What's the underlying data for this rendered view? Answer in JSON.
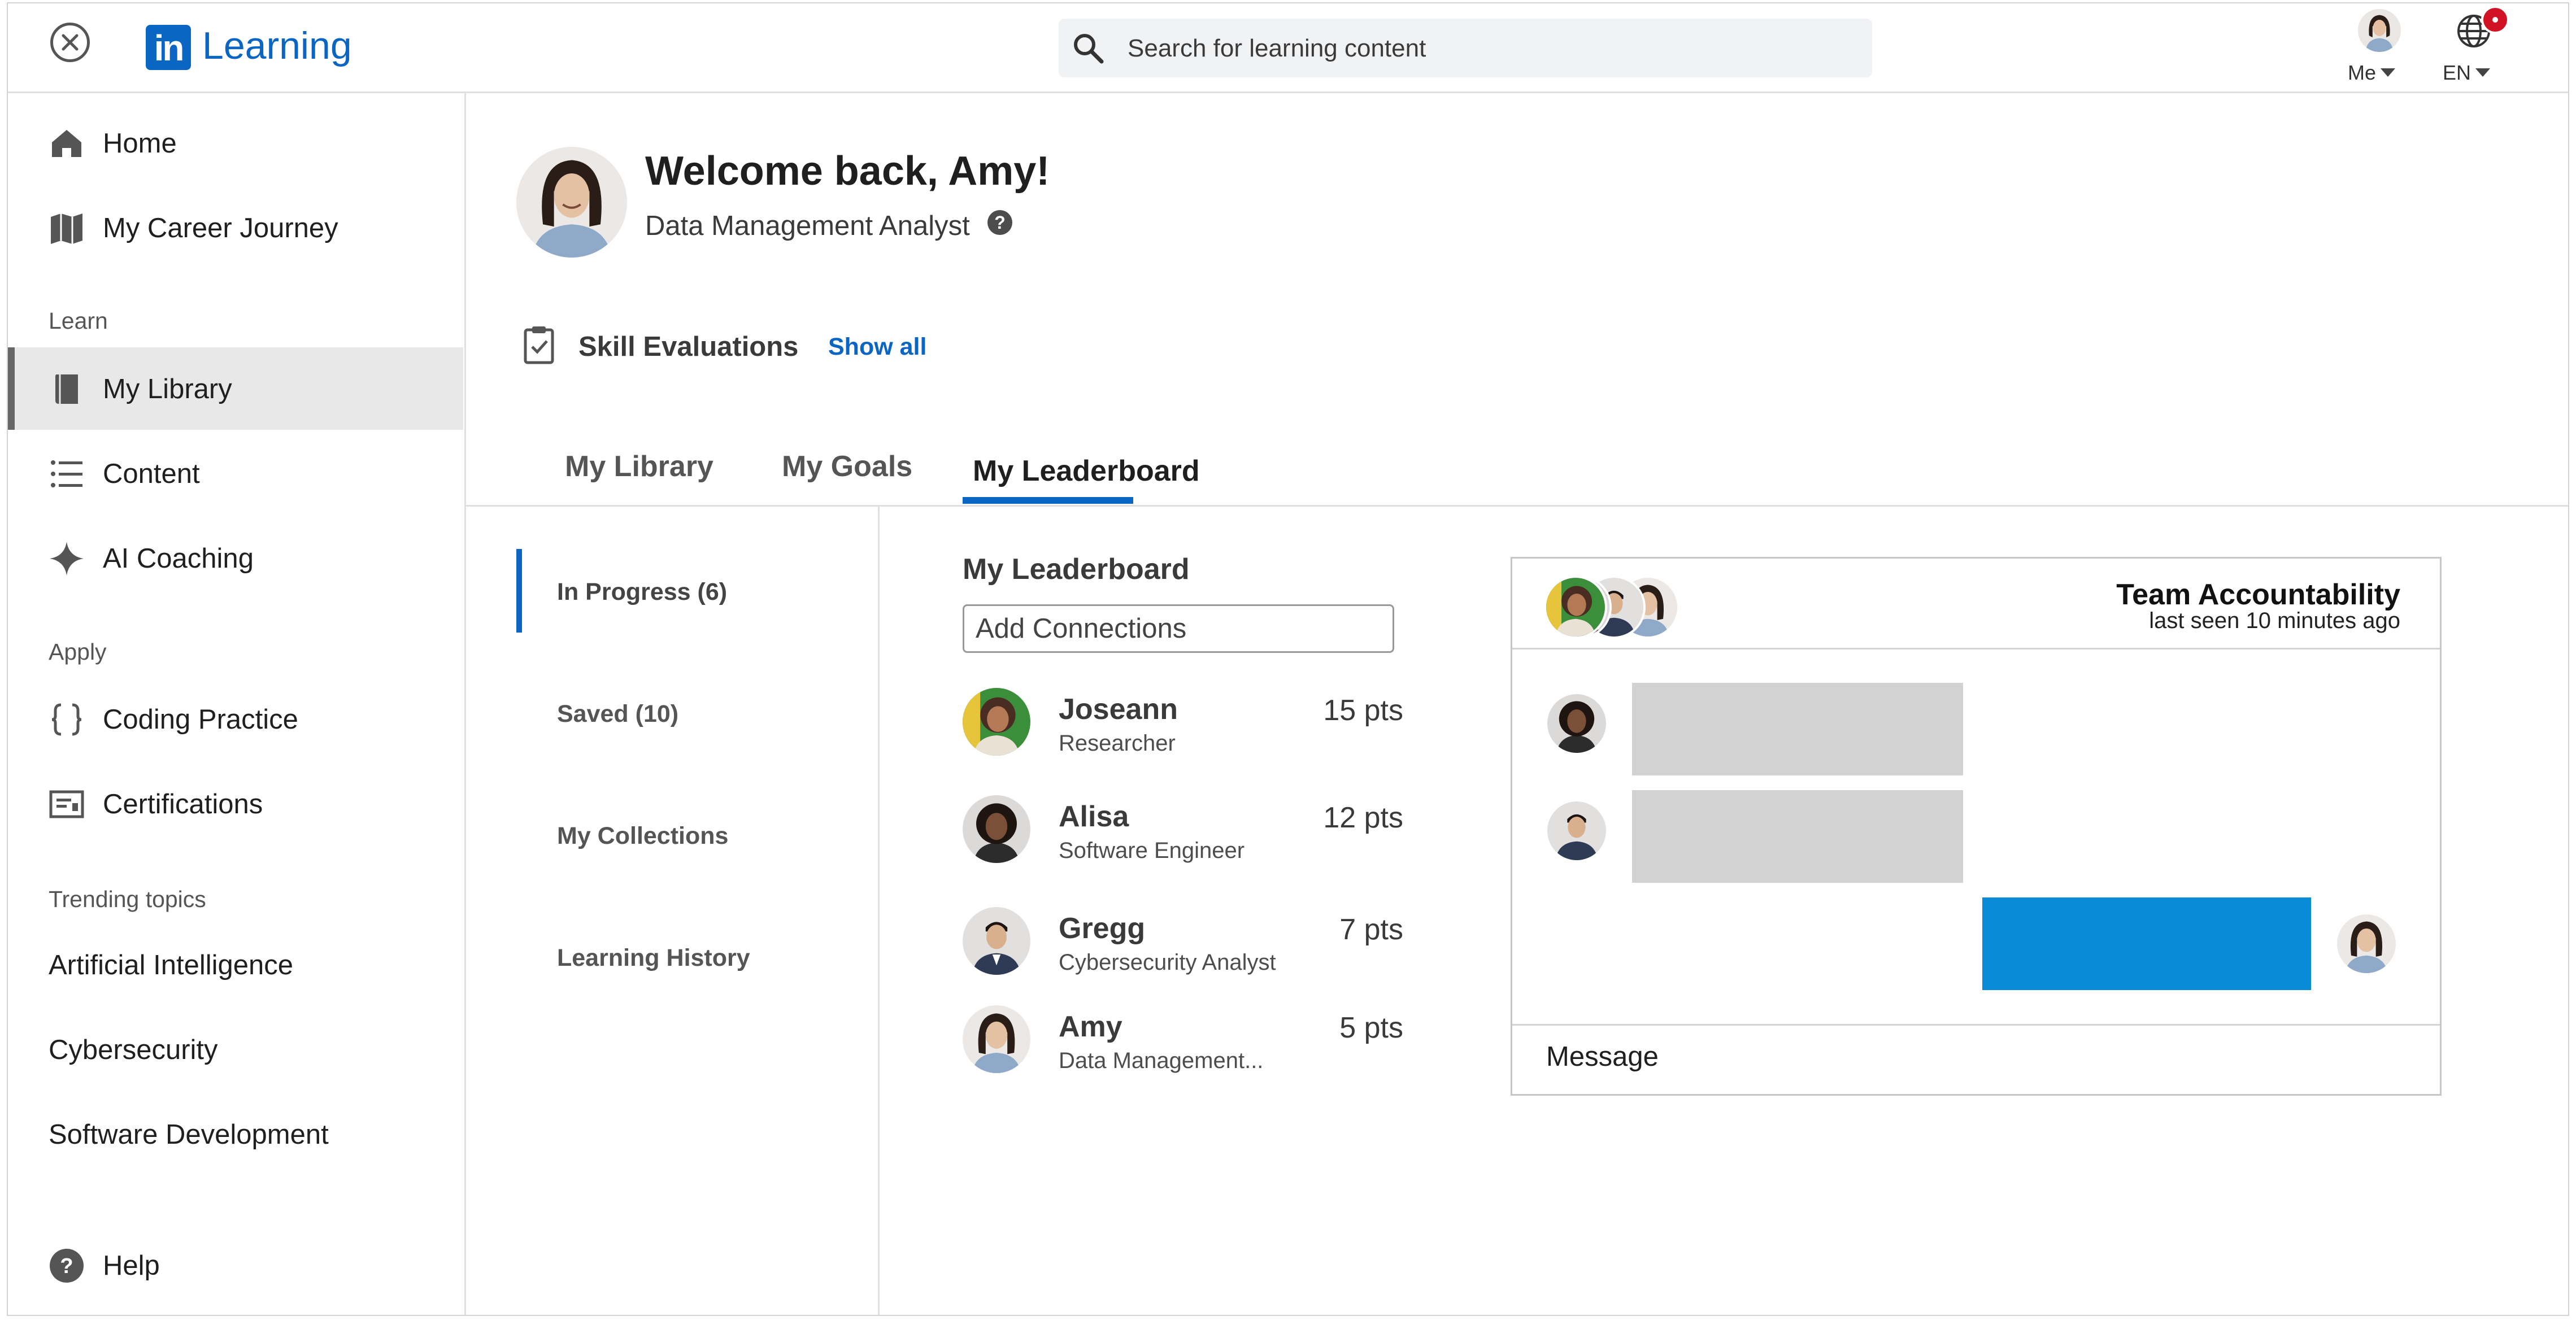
{
  "app": {
    "logo_text": "Learning",
    "logo_mark": "in",
    "search_placeholder": "Search for learning content",
    "me_label": "Me",
    "lang_label": "EN"
  },
  "sidebar": {
    "home": "Home",
    "career": "My Career Journey",
    "learn_header": "Learn",
    "library": "My Library",
    "content": "Content",
    "ai_coaching": "AI Coaching",
    "apply_header": "Apply",
    "coding": "Coding Practice",
    "certifications": "Certifications",
    "trending_header": "Trending topics",
    "trending": [
      "Artificial Intelligence",
      "Cybersecurity",
      "Software Development"
    ],
    "help": "Help"
  },
  "profile": {
    "welcome": "Welcome back, Amy!",
    "title": "Data Management Analyst",
    "help_glyph": "?"
  },
  "skills": {
    "label": "Skill Evaluations",
    "show_all": "Show all"
  },
  "tabs": [
    "My Library",
    "My Goals",
    "My Leaderboard"
  ],
  "active_tab": "My Leaderboard",
  "subnav": [
    "In Progress (6)",
    "Saved (10)",
    "My Collections",
    "Learning History"
  ],
  "leaderboard": {
    "title": "My Leaderboard",
    "add_placeholder": "Add Connections",
    "entries": [
      {
        "name": "Joseann",
        "role": "Researcher",
        "points": "15 pts"
      },
      {
        "name": "Alisa",
        "role": "Software Engineer",
        "points": "12 pts"
      },
      {
        "name": "Gregg",
        "role": "Cybersecurity Analyst",
        "points": "7 pts"
      },
      {
        "name": "Amy",
        "role": "Data Management...",
        "points": "5 pts"
      }
    ]
  },
  "chat": {
    "name": "Team Accountability",
    "last_seen": "last seen 10 minutes ago",
    "message_placeholder": "Message"
  },
  "colors": {
    "brand": "#0a66c2",
    "chat_bubble_self": "#0a8bd8",
    "chat_bubble_other": "#d2d2d2",
    "notification": "#d11124"
  }
}
